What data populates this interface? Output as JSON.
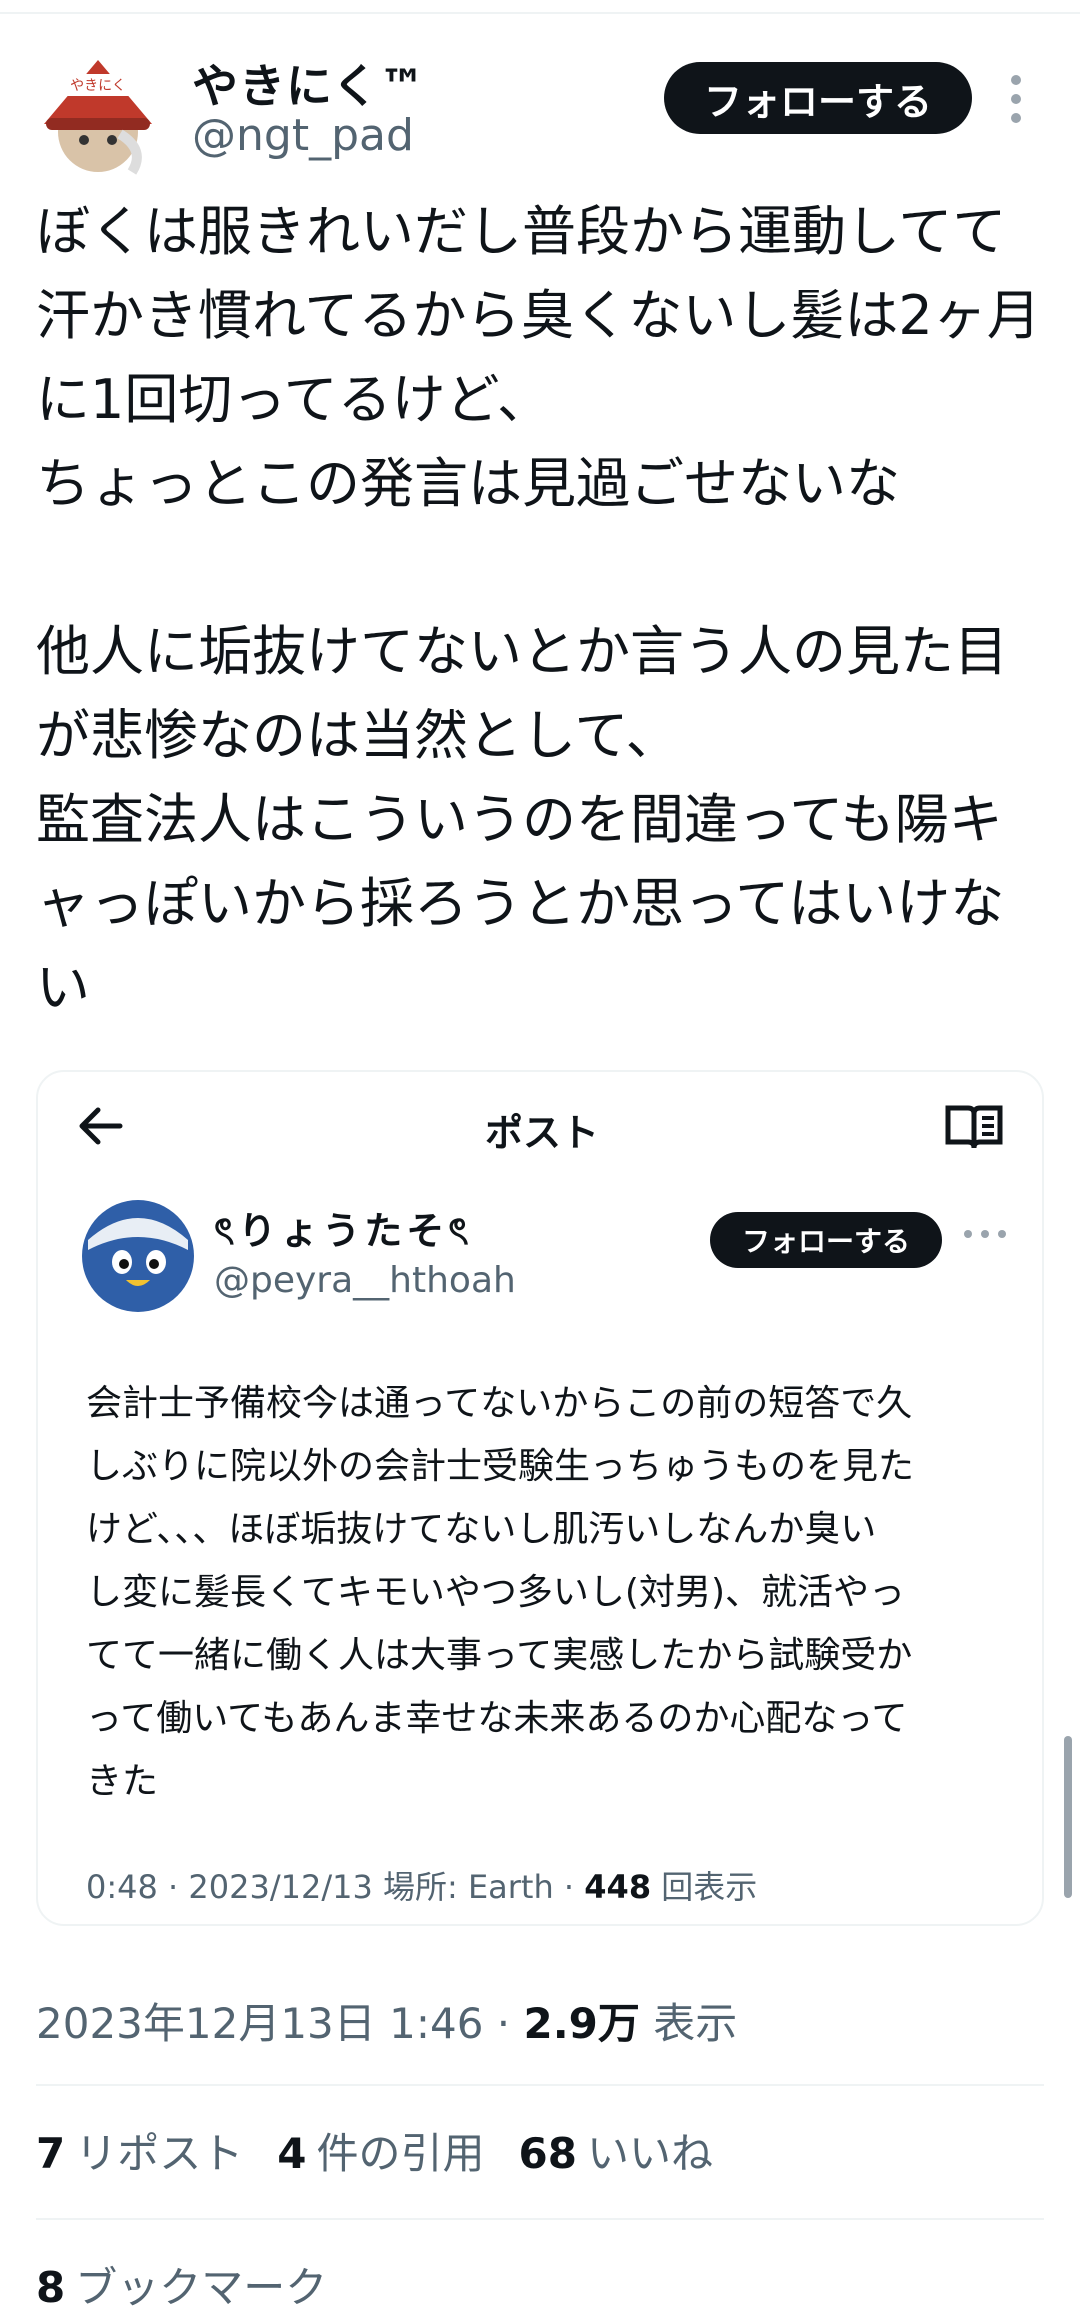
{
  "tweet": {
    "author": {
      "name": "やきにく™",
      "handle": "@ngt_pad",
      "avatar_text": "やきにく"
    },
    "follow_label": "フォローする",
    "text": "ぼくは服きれいだし普段から運動してて\n汗かき慣れてるから臭くないし髪は2ヶ月\nに1回切ってるけど、\nちょっとこの発言は見過ごせないな\n\n他人に垢抜けてないとか言う人の見た目\nが悲惨なのは当然として、\n監査法人はこういうのを間違っても陽キ\nャっぽいから採ろうとか思ってはいけな\nい",
    "meta": {
      "date": "2023年12月13日 1:46 · ",
      "views": "2.9万",
      "views_label": " 表示"
    },
    "stats": {
      "reposts": "7",
      "reposts_label": "リポスト",
      "quotes": "4",
      "quotes_label": "件の引用",
      "likes": "68",
      "likes_label": "いいね",
      "bookmarks": "8",
      "bookmarks_label": "ブックマーク"
    }
  },
  "quote": {
    "header": "ポスト",
    "author": {
      "name": "ৎりょうたそৎ",
      "handle": "@peyra__hthoah"
    },
    "follow_label": "フォローする",
    "text": "会計士予備校今は通ってないからこの前の短答で久\nしぶりに院以外の会計士受験生っちゅうものを見た\nけど、、、ほぼ垢抜けてないし肌汚いしなんか臭い\nし変に髪長くてキモいやつ多いし(対男)、就活やっ\nてて一緒に働く人は大事って実感したから試験受か\nって働いてもあんま幸せな未来あるのか心配なって\nきた",
    "meta": {
      "prefix": "0:48 · 2023/12/13 場所: Earth · ",
      "views": "448",
      "views_label": " 回表示"
    }
  },
  "icons": [
    "back-arrow-icon",
    "reader-book-icon",
    "more-vertical-icon",
    "more-horizontal-icon"
  ],
  "colors": {
    "text": "#0f1419",
    "secondary": "#536471",
    "border": "#eff3f4",
    "button": "#0f1419"
  }
}
